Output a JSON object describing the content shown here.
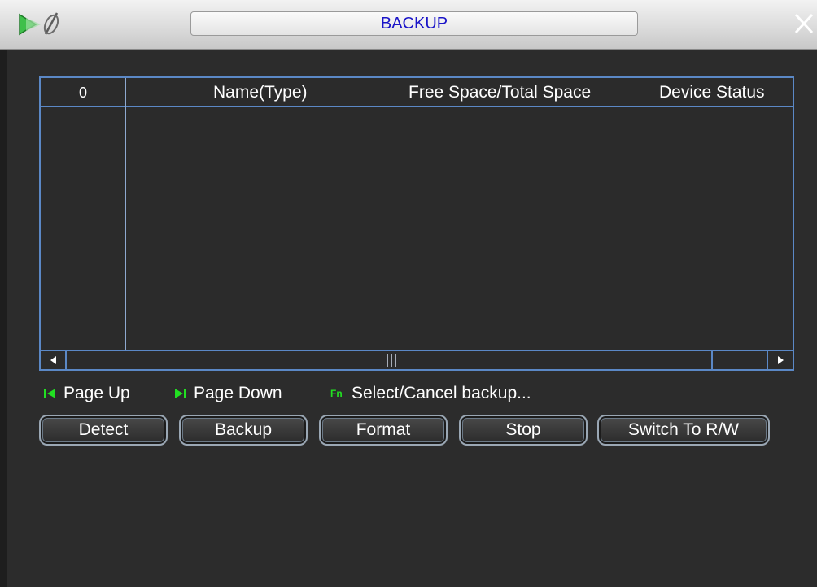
{
  "window": {
    "title": "BACKUP"
  },
  "icons": {
    "app": "backup-app-icon",
    "close": "close-icon",
    "scroll_left": "arrow-left-icon",
    "scroll_right": "arrow-right-icon",
    "page_up": "page-up-icon",
    "page_down": "page-down-icon",
    "fn": "fn-key-icon"
  },
  "table": {
    "columns": [
      "0",
      "Name(Type)",
      "Free Space/Total Space",
      "Device Status"
    ],
    "rows": []
  },
  "hints": {
    "page_up": "Page Up",
    "page_down": "Page Down",
    "fn_label": "Fn",
    "select_cancel": "Select/Cancel backup..."
  },
  "buttons": {
    "detect": "Detect",
    "backup": "Backup",
    "format": "Format",
    "stop": "Stop",
    "switch_rw": "Switch To R/W"
  },
  "colors": {
    "title_text": "#1a14c8",
    "table_border": "#5b88c6",
    "hint_icon": "#22e022",
    "background": "#2c2c2c"
  }
}
